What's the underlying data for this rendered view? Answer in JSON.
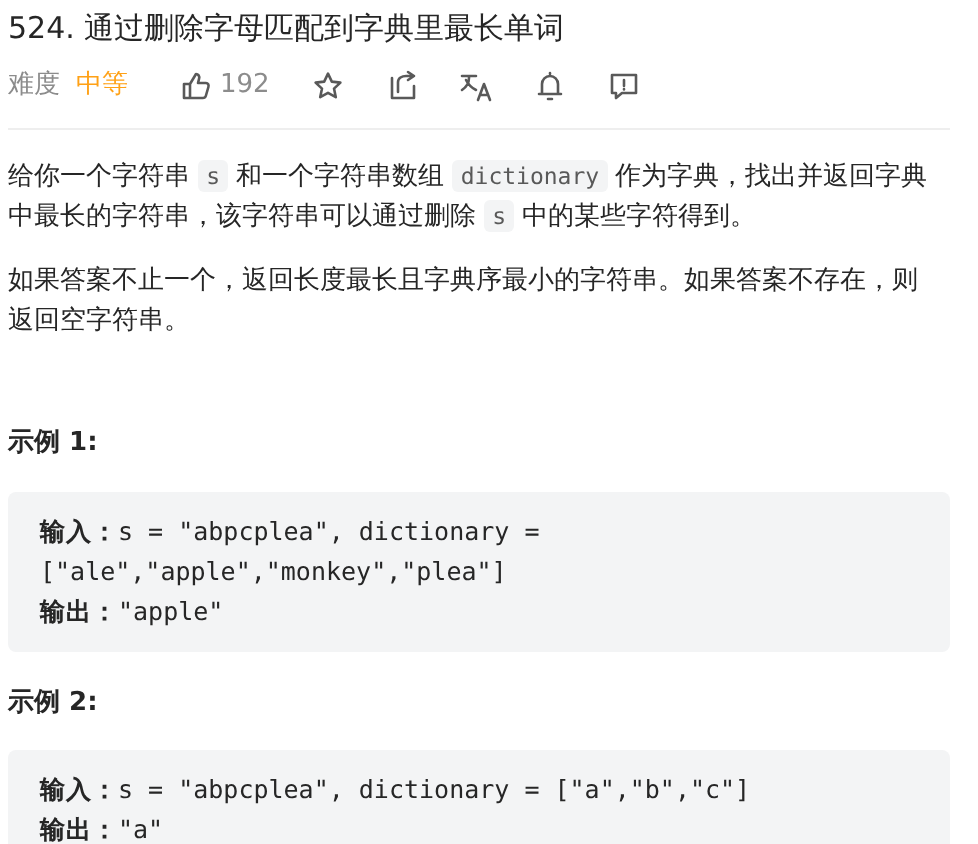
{
  "title": "524. 通过删除字母匹配到字典里最长单词",
  "meta": {
    "difficulty_label": "难度",
    "difficulty": "中等",
    "likes": "192"
  },
  "paragraphs": [
    [
      {
        "kind": "text",
        "text": "给你一个字符串 "
      },
      {
        "kind": "code",
        "text": "s"
      },
      {
        "kind": "text",
        "text": " 和一个字符串数组 "
      },
      {
        "kind": "code",
        "text": "dictionary"
      },
      {
        "kind": "text",
        "text": " 作为字典，找出并返回字典中最长的字符串，该字符串可以通过删除 "
      },
      {
        "kind": "code",
        "text": "s"
      },
      {
        "kind": "text",
        "text": " 中的某些字符得到。"
      }
    ],
    [
      {
        "kind": "text",
        "text": "如果答案不止一个，返回长度最长且字典序最小的字符串。如果答案不存在，则返回空字符串。"
      }
    ]
  ],
  "examples": [
    {
      "heading": "示例 1:",
      "lines": [
        {
          "label": "输入：",
          "value": "s = \"abpcplea\", dictionary ="
        },
        {
          "value": "[\"ale\",\"apple\",\"monkey\",\"plea\"]"
        },
        {
          "label": "输出：",
          "value": "\"apple\""
        }
      ]
    },
    {
      "heading": "示例 2:",
      "lines": [
        {
          "label": "输入：",
          "value": "s = \"abpcplea\", dictionary = [\"a\",\"b\",\"c\"]"
        },
        {
          "label": "输出：",
          "value": "\"a\""
        }
      ]
    }
  ]
}
